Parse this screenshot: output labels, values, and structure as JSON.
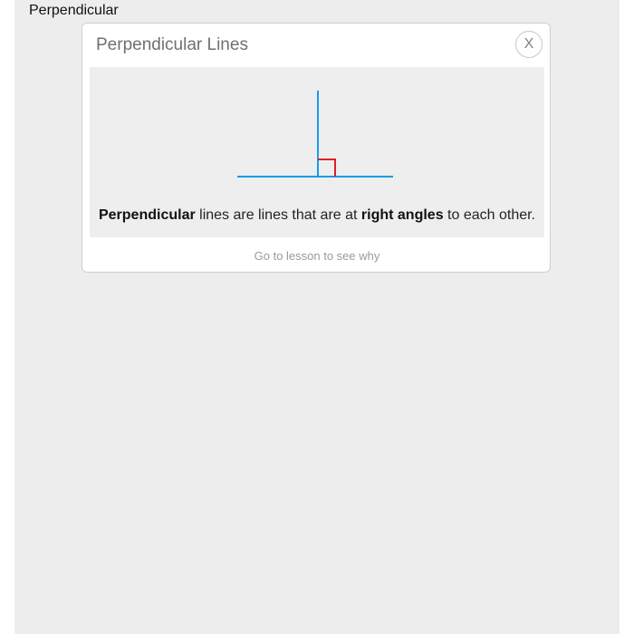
{
  "page": {
    "heading": "Perpendicular"
  },
  "card": {
    "title": "Perpendicular Lines",
    "close_label": "X",
    "definition": {
      "term": "Perpendicular",
      "part1": " lines are lines that are at ",
      "emphasis": "right angles",
      "part2": " to each other."
    },
    "lesson_link": "Go to lesson to see why"
  },
  "colors": {
    "line": "#1a9be8",
    "right_angle_marker": "#e02020"
  }
}
